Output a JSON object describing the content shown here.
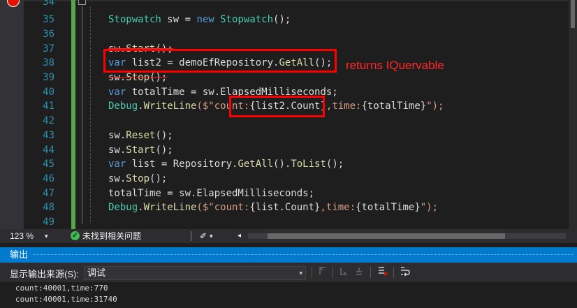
{
  "editor": {
    "line_numbers": [
      "34",
      "35",
      "36",
      "37",
      "38",
      "39",
      "40",
      "41",
      "42",
      "43",
      "44",
      "45",
      "46",
      "47",
      "48",
      "49"
    ],
    "code": {
      "l35": {
        "t1": "Stopwatch",
        "t2": " sw = ",
        "t3": "new",
        "t4": " ",
        "t5": "Stopwatch",
        "t6": "();"
      },
      "l37": {
        "t1": "sw.",
        "t2": "Start",
        "t3": "();"
      },
      "l38": {
        "t1": "var",
        "t2": " list2 = demoEfRepository.",
        "t3": "GetAll",
        "t4": "();"
      },
      "l39": {
        "t1": "sw.",
        "t2": "Stop",
        "t3": "();"
      },
      "l40": {
        "t1": "var",
        "t2": " totalTime = sw.ElapsedMilliseconds;"
      },
      "l41": {
        "t1": "Debug",
        "t2": ".",
        "t3": "WriteLine",
        "t4": "($\"count:",
        "t5": "{list2.Count}",
        "t6": ",time:",
        "t7": "{totalTime}",
        "t8": "\");"
      },
      "l43": {
        "t1": "sw.",
        "t2": "Reset",
        "t3": "();"
      },
      "l44": {
        "t1": "sw.",
        "t2": "Start",
        "t3": "();"
      },
      "l45": {
        "t1": "var",
        "t2": " list = Repository.",
        "t3": "GetAll",
        "t4": "().",
        "t5": "ToList",
        "t6": "();"
      },
      "l46": {
        "t1": "sw.",
        "t2": "Stop",
        "t3": "();"
      },
      "l47": {
        "t1": "totalTime = sw.ElapsedMilliseconds;"
      },
      "l48": {
        "t1": "Debug",
        "t2": ".",
        "t3": "WriteLine",
        "t4": "($\"count:",
        "t5": "{list.Count}",
        "t6": ",time:",
        "t7": "{totalTime}",
        "t8": "\");"
      }
    },
    "annotation": "returns IQuervable"
  },
  "statusbar": {
    "zoom": "123 %",
    "zoom_dropdown": "▾",
    "issues_icon": "✓",
    "issues": "未找到相关问题",
    "brush_icon": "✐",
    "brush_dropdown": "▾",
    "scroll_left": "◂"
  },
  "output": {
    "title": "输出",
    "source_label": "显示输出来源(S):",
    "source_value": "调试",
    "source_arrow": "▾",
    "lines": [
      "count:40001,time:770",
      "count:40001,time:31740"
    ]
  },
  "colors": {
    "keyword": "#569cd6",
    "type": "#4ec9b0",
    "method": "#dcdcaa",
    "string": "#d69d85",
    "line_number": "#2b91af",
    "annotation": "#ff2a2a",
    "output_title_bg": "#007acc"
  }
}
